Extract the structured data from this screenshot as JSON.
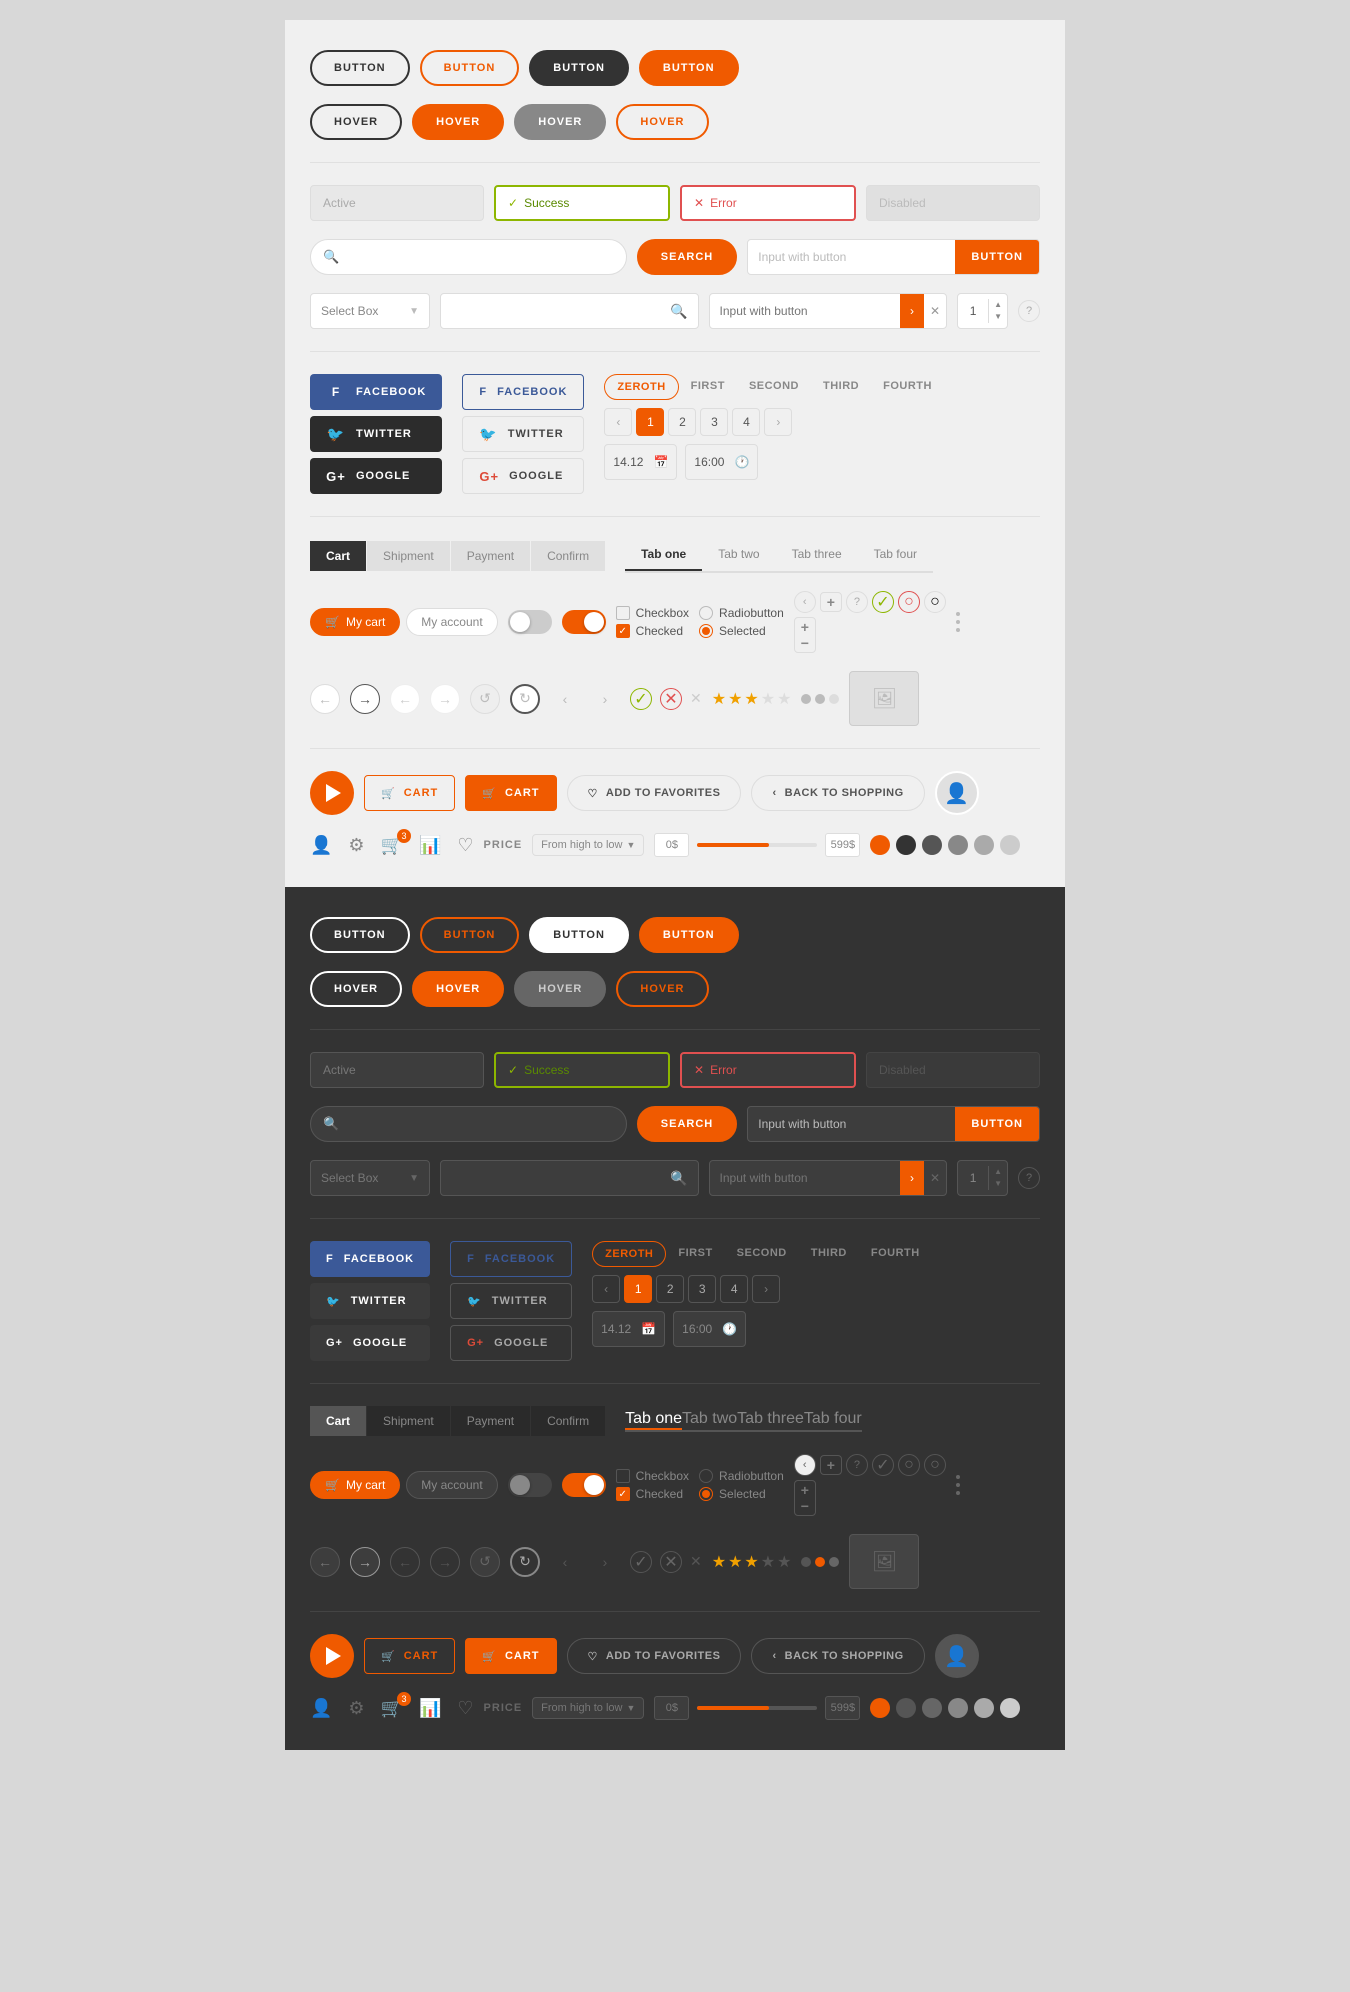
{
  "light": {
    "buttons": {
      "row1": [
        "BUTTON",
        "BUTTON",
        "BUTTON",
        "BUTTON"
      ],
      "row2": [
        "HOVER",
        "HOVER",
        "HOVER",
        "HOVER"
      ],
      "styles_r1": [
        "outline-dark",
        "outline-orange",
        "dark",
        "orange"
      ],
      "styles_r2": [
        "hover-dark",
        "hover-orange",
        "hover-gray",
        "hover-orange-outline"
      ]
    },
    "states": {
      "active": "Active",
      "success": "Success",
      "error": "Error",
      "disabled": "Disabled"
    },
    "search": {
      "placeholder": "",
      "btn": "SEARCH"
    },
    "input_btn": {
      "placeholder": "Input with button",
      "btn": "BUTTON"
    },
    "select": {
      "label": "Select Box"
    },
    "input_arrow": {
      "placeholder": "Input with button"
    },
    "num_val": "1",
    "social": {
      "fb": "FACEBOOK",
      "tw": "TWITTER",
      "gp": "GOOGLE"
    },
    "tabs_text": [
      "ZEROTH",
      "FIRST",
      "SECOND",
      "THIRD",
      "FOURTH"
    ],
    "pagination": [
      "‹",
      "1",
      "2",
      "3",
      "4",
      "›"
    ],
    "date": "14.12",
    "time": "16:00",
    "progress_tabs": [
      "Cart",
      "Shipment",
      "Payment",
      "Confirm"
    ],
    "icon_tabs": [
      "Tab one",
      "Tab two",
      "Tab three",
      "Tab four"
    ],
    "cart_tabs": [
      "My cart",
      "My account"
    ],
    "add_fav": "ADD TO FAVORITES",
    "back_shop": "BACK TO SHOPPING",
    "cart_outline": "CART",
    "cart_solid": "CART",
    "price_label": "PRICE",
    "sort_label": "From high to low",
    "range_min": "0$",
    "range_max": "599$",
    "swatches": [
      "#f05a00",
      "#333333",
      "#555555",
      "#888888",
      "#aaaaaa",
      "#cccccc"
    ]
  },
  "dark": {
    "buttons": {
      "row1": [
        "BUTTON",
        "BUTTON",
        "BUTTON",
        "BUTTON"
      ],
      "row2": [
        "HOVER",
        "HOVER",
        "HOVER",
        "HOVER"
      ]
    },
    "states": {
      "active": "Active",
      "success": "Success",
      "error": "Error",
      "disabled": "Disabled"
    },
    "search": {
      "placeholder": "",
      "btn": "SEARCH"
    },
    "input_btn": {
      "placeholder": "Input with button",
      "btn": "BUTTON"
    },
    "select": {
      "label": "Select Box"
    },
    "input_arrow": {
      "placeholder": "Input with button"
    },
    "social": {
      "fb": "FACEBOOK",
      "tw": "TWITTER",
      "gp": "GOOGLE"
    },
    "tabs_text": [
      "ZEROTH",
      "FIRST",
      "SECOND",
      "THIRD",
      "FOURTH"
    ],
    "pagination": [
      "‹",
      "1",
      "2",
      "3",
      "4",
      "›"
    ],
    "date": "14.12",
    "time": "16:00",
    "progress_tabs": [
      "Cart",
      "Shipment",
      "Payment",
      "Confirm"
    ],
    "icon_tabs": [
      "Tab one",
      "Tab two",
      "Tab three",
      "Tab four"
    ],
    "cart_tabs": [
      "My cart",
      "My account"
    ],
    "add_fav": "ADD TO FAVORITES",
    "back_shop": "BACK TO SHOPPING",
    "cart_outline": "CART",
    "cart_solid": "CART",
    "price_label": "PRICE",
    "sort_label": "From high to low",
    "range_min": "0$",
    "range_max": "599$",
    "swatches": [
      "#f05a00",
      "#444444",
      "#555555",
      "#777777",
      "#999999",
      "#bbbbbb"
    ]
  }
}
